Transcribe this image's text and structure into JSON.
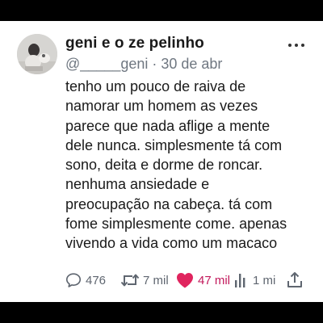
{
  "post": {
    "author": {
      "display_name": "geni e o ze pelinho",
      "handle": "@_____geni",
      "date": "· 30 de abr"
    },
    "text_lines": [
      "tenho um pouco de raiva de",
      "namorar um homem as vezes",
      "parece que nada aflige a  mente",
      "dele nunca. simplesmente tá com",
      "sono, deita e dorme de roncar.",
      "nenhuma ansiedade e",
      "preocupação na cabeça. tá com",
      "fome simplesmente come. apenas",
      "vivendo a vida como um macaco"
    ],
    "stats": {
      "replies": "476",
      "reposts": "7 mil",
      "likes": "47 mil",
      "views": "1 mi"
    },
    "icons": {
      "avatar": "profile-photo",
      "more": "more-horizontal-icon",
      "reply": "reply-bubble-icon",
      "repost": "repost-arrows-icon",
      "like": "heart-filled-icon",
      "views": "bar-chart-icon",
      "share": "share-upload-icon"
    },
    "colors": {
      "text": "#1a1a1a",
      "secondary": "#6f7781",
      "like": "#e0245e",
      "background": "#ffffff",
      "letterbox": "#000000"
    }
  }
}
